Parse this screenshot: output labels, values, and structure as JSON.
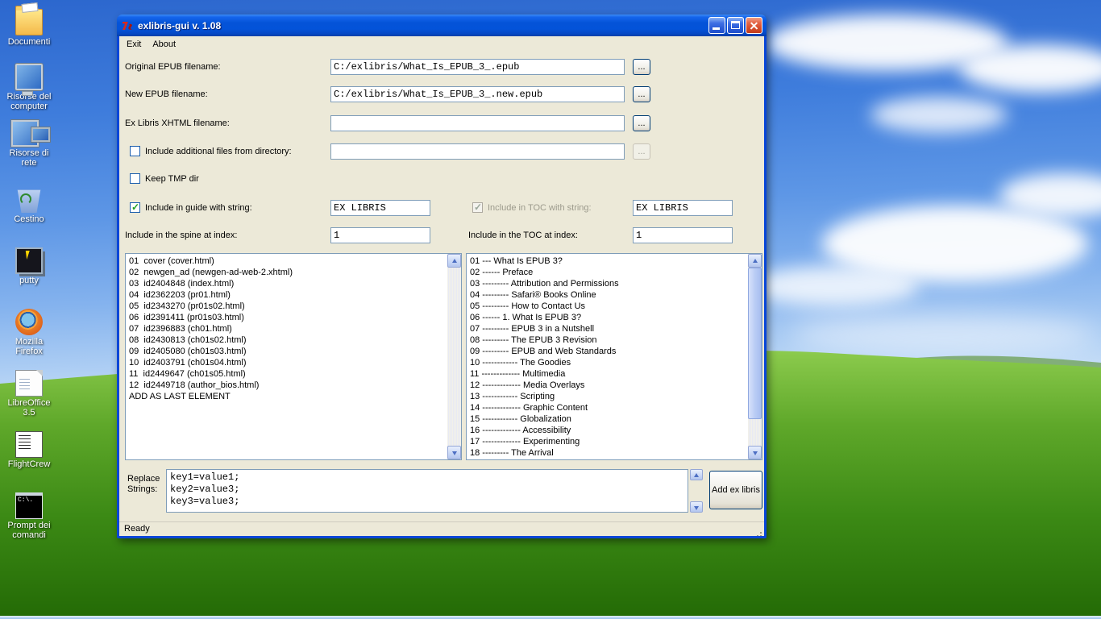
{
  "colors": {
    "titlebar": "#0453D8",
    "window_face": "#ECE9D8",
    "check_green": "#21A121",
    "close_red": "#D9512F"
  },
  "desktop": {
    "icons": [
      {
        "label": "Documenti",
        "type": "folder"
      },
      {
        "label": "Risorse del computer",
        "type": "computer"
      },
      {
        "label": "Risorse di rete",
        "type": "network"
      },
      {
        "label": "Cestino",
        "type": "recycle"
      },
      {
        "label": "putty",
        "type": "putty"
      },
      {
        "label": "Mozilla Firefox",
        "type": "firefox"
      },
      {
        "label": "LibreOffice 3.5",
        "type": "libreoffice"
      },
      {
        "label": "FlightCrew",
        "type": "flightcrew"
      },
      {
        "label": "Prompt dei comandi",
        "type": "cmd"
      }
    ]
  },
  "window": {
    "title": "exlibris-gui v. 1.08",
    "menu": {
      "exit": "Exit",
      "about": "About"
    },
    "form": {
      "original": {
        "label": "Original EPUB filename:",
        "value": "C:/exlibris/What_Is_EPUB_3_.epub",
        "browse": "..."
      },
      "new_file": {
        "label": "New EPUB filename:",
        "value": "C:/exlibris/What_Is_EPUB_3_.new.epub",
        "browse": "..."
      },
      "xhtml": {
        "label": "Ex Libris XHTML filename:",
        "value": "",
        "browse": "..."
      },
      "include_dir": {
        "label": "Include additional files from directory:",
        "checked": false,
        "value": "",
        "browse": "..."
      },
      "keep_tmp": {
        "label": "Keep TMP dir",
        "checked": false
      },
      "guide": {
        "label": "Include in guide with string:",
        "checked": true,
        "value": "EX LIBRIS"
      },
      "toc_string": {
        "label": "Include in TOC with string:",
        "checked": true,
        "value": "EX LIBRIS"
      },
      "spine_index": {
        "label": "Include in the spine at index:",
        "value": "1"
      },
      "toc_index": {
        "label": "Include in the TOC at index:",
        "value": "1"
      }
    },
    "spine_list": [
      "01  cover (cover.html)",
      "02  newgen_ad (newgen-ad-web-2.xhtml)",
      "03  id2404848 (index.html)",
      "04  id2362203 (pr01.html)",
      "05  id2343270 (pr01s02.html)",
      "06  id2391411 (pr01s03.html)",
      "07  id2396883 (ch01.html)",
      "08  id2430813 (ch01s02.html)",
      "09  id2405080 (ch01s03.html)",
      "10  id2403791 (ch01s04.html)",
      "11  id2449647 (ch01s05.html)",
      "12  id2449718 (author_bios.html)",
      "ADD AS LAST ELEMENT"
    ],
    "toc_list": [
      "01 --- What Is EPUB 3?",
      "02 ------ Preface",
      "03 --------- Attribution and Permissions",
      "04 --------- Safari® Books Online",
      "05 --------- How to Contact Us",
      "06 ------ 1. What Is EPUB 3?",
      "07 --------- EPUB 3 in a Nutshell",
      "08 --------- The EPUB 3 Revision",
      "09 --------- EPUB and Web Standards",
      "10 ------------ The Goodies",
      "11 ------------- Multimedia",
      "12 ------------- Media Overlays",
      "13 ------------ Scripting",
      "14 ------------- Graphic Content",
      "15 ------------ Globalization",
      "16 ------------- Accessibility",
      "17 ------------- Experimenting",
      "18 --------- The Arrival"
    ],
    "replace": {
      "label": "Replace Strings:",
      "value": "key1=value1;\nkey2=value3;\nkey3=value3;"
    },
    "add_button": "Add ex libris",
    "status": "Ready"
  }
}
